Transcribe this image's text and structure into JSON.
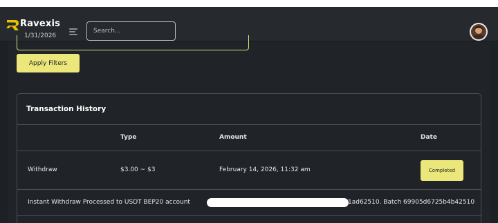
{
  "app": {
    "brand": "Ravexis",
    "brand_color": "#e6c200",
    "accent_color": "#ece77a",
    "logo_icon": "ravexis-r-logo-icon",
    "menu_icon": "hamburger-menu-icon"
  },
  "search": {
    "placeholder": "Search...",
    "value": ""
  },
  "filters": {
    "date_value": "1/31/2026",
    "apply_label": "Apply Filters"
  },
  "transactions": {
    "title": "Transaction History",
    "columns": [
      "",
      "Type",
      "Amount",
      "Date"
    ],
    "rows": [
      {
        "type": "Withdraw",
        "amount": "$3.00 ~ $3",
        "date": "February 14, 2026, 11:32 am",
        "status": "Completed",
        "description_start": "Instant Withdraw Processed to USDT BEP20 account",
        "description_end": "1ad62510. Batch 69905d6725b4b42510"
      }
    ]
  }
}
